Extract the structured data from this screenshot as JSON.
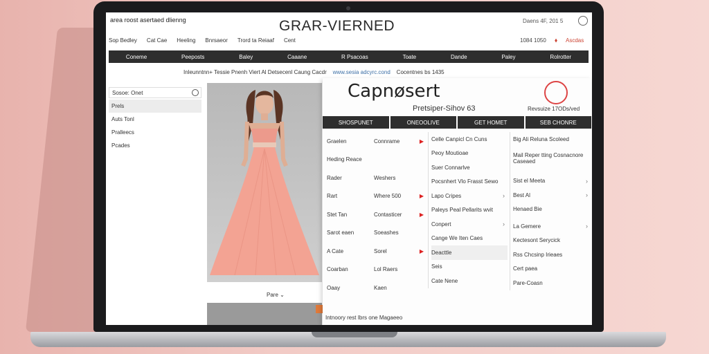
{
  "site": {
    "name": "area roost asertaed dlienng",
    "logo": "GRAR-VIERNED",
    "top_right": "Daens 4F, 201 5",
    "links": [
      "Sop Bedley",
      "Cat Cae",
      "Heeling",
      "Bnrsaeor",
      "Trord ta Reiaaf",
      "Cent"
    ],
    "ship": "1084 1050",
    "cart": "Ascdas"
  },
  "nav": [
    "Coneme",
    "Peeposts",
    "Baley",
    "Caaane",
    "R Psacoas",
    "Toate",
    "Dande",
    "Paley",
    "Rolrotter"
  ],
  "banner": {
    "text": "Inleunntnn+ Tessie Pnenh Viert Al Detsecenl Caung Cacdr",
    "link": "www.sesia adcyrc.cond",
    "tail": "Cocentnes bs 1435"
  },
  "sidebar": {
    "search_value": "Sosoe: Onet",
    "items": [
      "Prels",
      "Auts Tonl",
      "Pralleecs",
      "Pcades"
    ]
  },
  "product": {
    "view_label": "Pare"
  },
  "mega_menu": {
    "logo": "Capnøsert",
    "subtitle": "Pretsiper-Sihov 63",
    "right_text": "Revsuize 17ODs/ved",
    "tabs": [
      "SHOSPUNET",
      "ONEOOLIVE",
      "GET HOMET",
      "SEB CHONRE"
    ],
    "col1": [
      "Graelen",
      "Heding Reace",
      "Rader",
      "Rart",
      "Stet Tan",
      "Sarot eaen",
      "A Cate",
      "Coarban",
      "Oaay"
    ],
    "col2": [
      "Connrame",
      "",
      "Weshers",
      "Where 500",
      "Contasticer",
      "Soeashes",
      "Sorel",
      "Lol Raers",
      "Kaen"
    ],
    "col3": [
      "Celle Canpicl Cn Cuns",
      "Peoy Moutioae",
      "Suer Connarlve",
      "Pocsnhert Vlo Frasst Sewo",
      "Lapo Cripes",
      "Paleys Peal Pellarits wvit",
      "Conpert",
      "Cange We Iten Caes",
      "Deacttle",
      "Seis",
      "Cate Nene"
    ],
    "col4": [
      "Big Ali Reluna Scoleed",
      "Mail Reper tting Cosnacnore Caseaed",
      "",
      "Sist el Meeta",
      "Best Al",
      "Henaed Bie",
      "",
      "La Gemere",
      "Kectesont Serycick",
      "Rss Chcsinp Irieaes",
      "Cert paea",
      "Pare-Coasn"
    ],
    "footer": "Intnoory rest Ibrs one Magaeeo"
  }
}
